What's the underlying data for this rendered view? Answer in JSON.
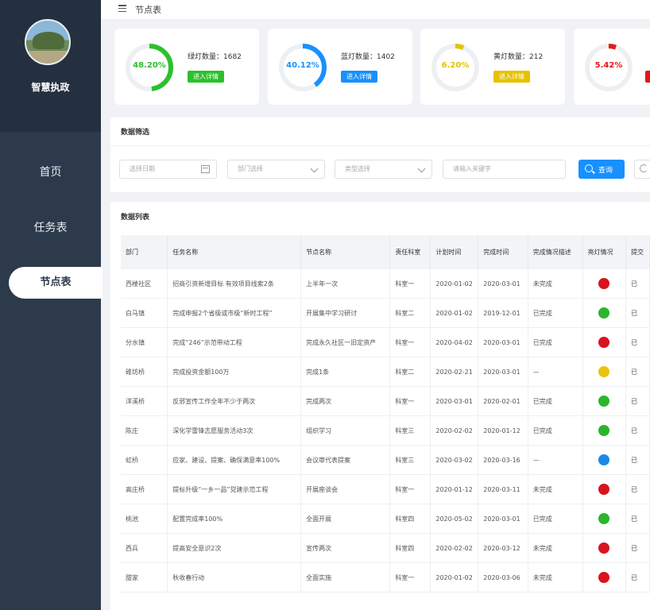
{
  "app": {
    "name": "智慧执政"
  },
  "nav": {
    "items": [
      {
        "label": "首页"
      },
      {
        "label": "任务表"
      },
      {
        "label": "节点表"
      }
    ]
  },
  "header": {
    "title": "节点表"
  },
  "stats": [
    {
      "percent_label": "48.20%",
      "ratio": 0.482,
      "label": "绿灯数量：1682",
      "button": "进入详情",
      "color": "#2bc12b"
    },
    {
      "percent_label": "40.12%",
      "ratio": 0.4012,
      "label": "蓝灯数量：1402",
      "button": "进入详情",
      "color": "#1890ff"
    },
    {
      "percent_label": "6.20%",
      "ratio": 0.062,
      "label": "黄灯数量：212",
      "button": "进入详情",
      "color": "#e6c200"
    },
    {
      "percent_label": "5.42%",
      "ratio": 0.0542,
      "label": "",
      "button": "",
      "color": "#e21818"
    }
  ],
  "filter": {
    "title": "数据筛选",
    "date_placeholder": "选择日期",
    "dept_placeholder": "部门选择",
    "type_placeholder": "类型选择",
    "keyword_placeholder": "请输入关键字",
    "query_label": "查询"
  },
  "list": {
    "title": "数据列表",
    "columns": [
      "部门",
      "任务名称",
      "节点名称",
      "责任科室",
      "计划时间",
      "完成时间",
      "完成情况描述",
      "亮灯情况",
      "提交"
    ],
    "rows": [
      {
        "dept": "西楼社区",
        "task": "招商引资新增目标 有效项目线索2条",
        "node": "上半年一次",
        "office": "科室一",
        "plan": "2020-01-02",
        "done": "2020-03-01",
        "status": "未完成",
        "light": "red",
        "extra": "已"
      },
      {
        "dept": "白马镇",
        "task": "完成申报2个省级或市级“新时工程”",
        "node": "开展集中学习研讨",
        "office": "科室二",
        "plan": "2020-01-02",
        "done": "2019-12-01",
        "status": "已完成",
        "light": "green",
        "extra": "已"
      },
      {
        "dept": "分水镇",
        "task": "完成“246”示范带动工程",
        "node": "完成永久社区一旧定资产",
        "office": "科室一",
        "plan": "2020-04-02",
        "done": "2020-03-01",
        "status": "已完成",
        "light": "red",
        "extra": "已"
      },
      {
        "dept": "碓坊桥",
        "task": "完成投资金额100万",
        "node": "完成1条",
        "office": "科室二",
        "plan": "2020-02-21",
        "done": "2020-03-01",
        "status": "—",
        "light": "yellow",
        "extra": "已"
      },
      {
        "dept": "洋溪桥",
        "task": "反邪宣传工作全年不少于两次",
        "node": "完成两次",
        "office": "科室一",
        "plan": "2020-03-01",
        "done": "2020-02-01",
        "status": "已完成",
        "light": "green",
        "extra": "已"
      },
      {
        "dept": "陈庄",
        "task": "深化学雷锋志愿服务活动3次",
        "node": "组织学习",
        "office": "科室三",
        "plan": "2020-02-02",
        "done": "2020-01-12",
        "status": "已完成",
        "light": "green",
        "extra": "已"
      },
      {
        "dept": "虹桥",
        "task": "应家、建设、提案、确保满意率100%",
        "node": "会议审代表提案",
        "office": "科室三",
        "plan": "2020-03-02",
        "done": "2020-03-16",
        "status": "—",
        "light": "blue",
        "extra": "已"
      },
      {
        "dept": "高庄桥",
        "task": "提标升级“一乡一品”党建示范工程",
        "node": "开展座谈会",
        "office": "科室一",
        "plan": "2020-01-12",
        "done": "2020-03-11",
        "status": "未完成",
        "light": "red",
        "extra": "已"
      },
      {
        "dept": "桃池",
        "task": "配置完成率100%",
        "node": "全面开展",
        "office": "科室四",
        "plan": "2020-05-02",
        "done": "2020-03-01",
        "status": "已完成",
        "light": "green",
        "extra": "已"
      },
      {
        "dept": "西兵",
        "task": "提高安全意识2次",
        "node": "宣传两次",
        "office": "科室四",
        "plan": "2020-02-02",
        "done": "2020-03-12",
        "status": "未完成",
        "light": "red",
        "extra": "已"
      },
      {
        "dept": "甜家",
        "task": "秋收春行动",
        "node": "全面实施",
        "office": "科室一",
        "plan": "2020-01-02",
        "done": "2020-03-06",
        "status": "未完成",
        "light": "red",
        "extra": "已"
      }
    ]
  },
  "light_colors": {
    "red": "#d9141e",
    "green": "#2bb52b",
    "yellow": "#e8c40f",
    "blue": "#1a8ae6"
  }
}
